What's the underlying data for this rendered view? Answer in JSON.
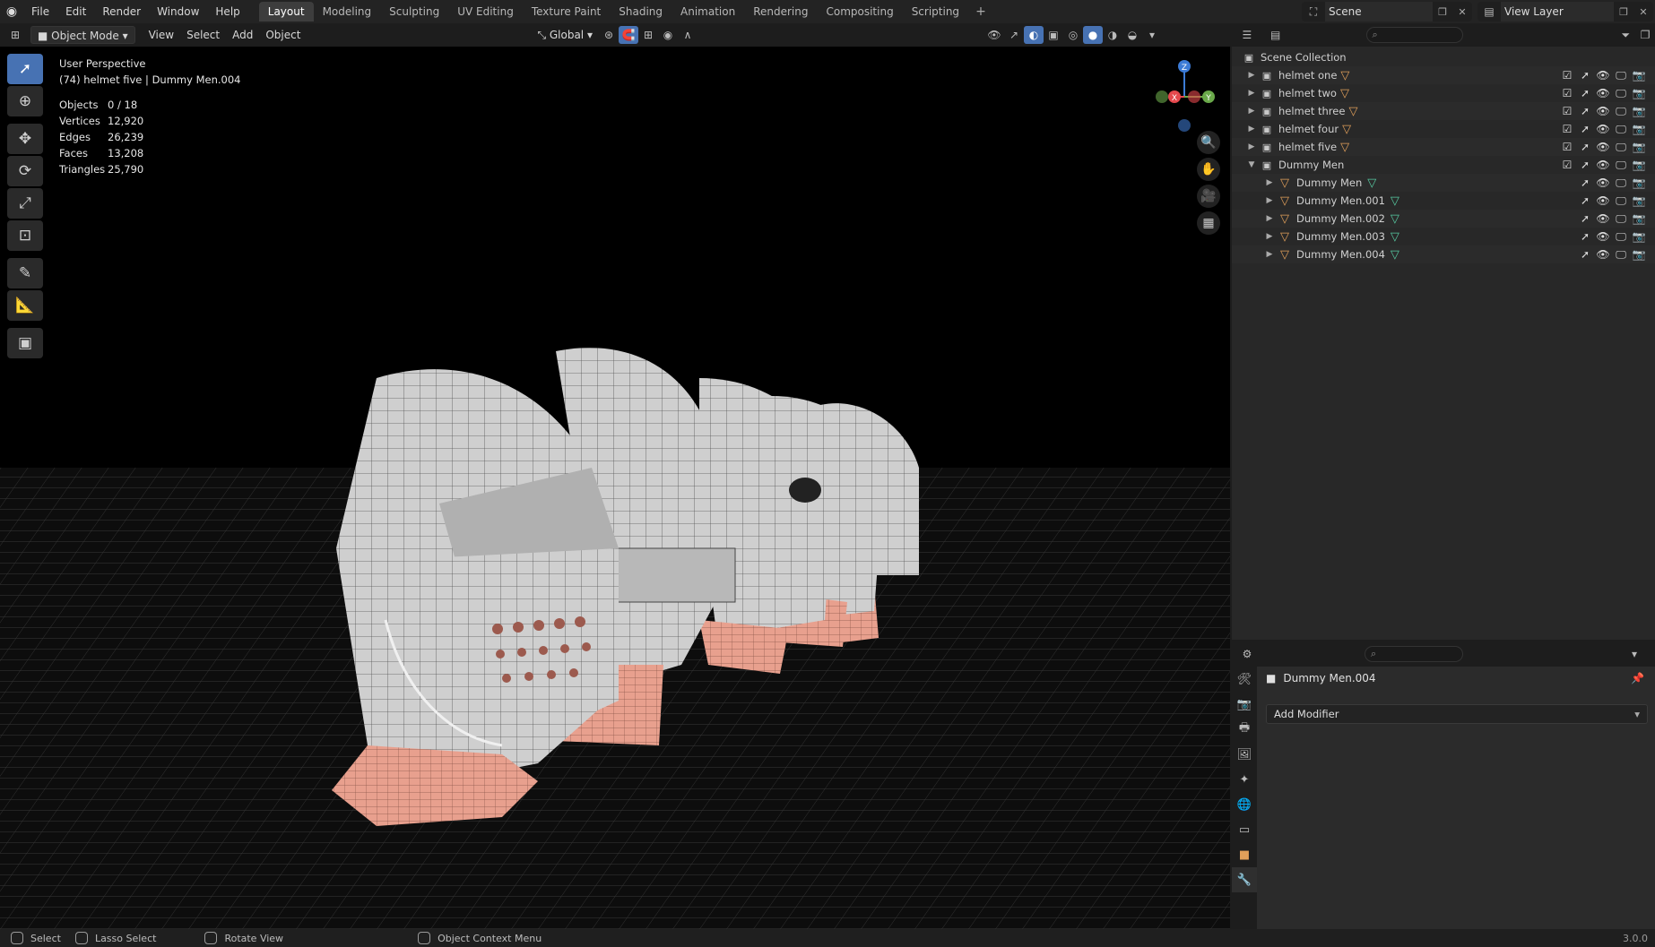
{
  "menu": {
    "logo_icon": "blender-logo-icon",
    "items": [
      "File",
      "Edit",
      "Render",
      "Window",
      "Help"
    ]
  },
  "workspaces": {
    "tabs": [
      "Layout",
      "Modeling",
      "Sculpting",
      "UV Editing",
      "Texture Paint",
      "Shading",
      "Animation",
      "Rendering",
      "Compositing",
      "Scripting"
    ],
    "active": "Layout",
    "add_label": "+"
  },
  "scene": {
    "value": "Scene"
  },
  "view_layer": {
    "value": "View Layer"
  },
  "viewport_header": {
    "mode": "Object Mode",
    "menus": [
      "View",
      "Select",
      "Add",
      "Object"
    ],
    "orientation": "Global"
  },
  "viewport": {
    "perspective": "User Perspective",
    "active_info": "(74) helmet five | Dummy Men.004",
    "stats": [
      {
        "label": "Objects",
        "value": "0 / 18"
      },
      {
        "label": "Vertices",
        "value": "12,920"
      },
      {
        "label": "Edges",
        "value": "26,239"
      },
      {
        "label": "Faces",
        "value": "13,208"
      },
      {
        "label": "Triangles",
        "value": "25,790"
      }
    ],
    "gizmo_axes": {
      "x": "X",
      "y": "Y",
      "z": "Z"
    },
    "colors": {
      "x": "#e5484d",
      "y": "#6aa94a",
      "z": "#3c7bd6",
      "skin": "#e8a08e",
      "helmet": "#d7d7d7"
    }
  },
  "outliner": {
    "root": "Scene Collection",
    "rows": [
      {
        "name": "helmet one",
        "type": "collection"
      },
      {
        "name": "helmet two",
        "type": "collection"
      },
      {
        "name": "helmet three",
        "type": "collection"
      },
      {
        "name": "helmet four",
        "type": "collection"
      },
      {
        "name": "helmet five",
        "type": "collection"
      },
      {
        "name": "Dummy Men",
        "type": "collection-open"
      },
      {
        "name": "Dummy Men",
        "type": "object"
      },
      {
        "name": "Dummy Men.001",
        "type": "object"
      },
      {
        "name": "Dummy Men.002",
        "type": "object"
      },
      {
        "name": "Dummy Men.003",
        "type": "object"
      },
      {
        "name": "Dummy Men.004",
        "type": "object"
      }
    ]
  },
  "properties": {
    "object_name": "Dummy Men.004",
    "add_modifier": "Add Modifier"
  },
  "statusbar": {
    "items": [
      "Select",
      "Lasso Select",
      "Rotate View",
      "Object Context Menu"
    ],
    "version": "3.0.0"
  }
}
